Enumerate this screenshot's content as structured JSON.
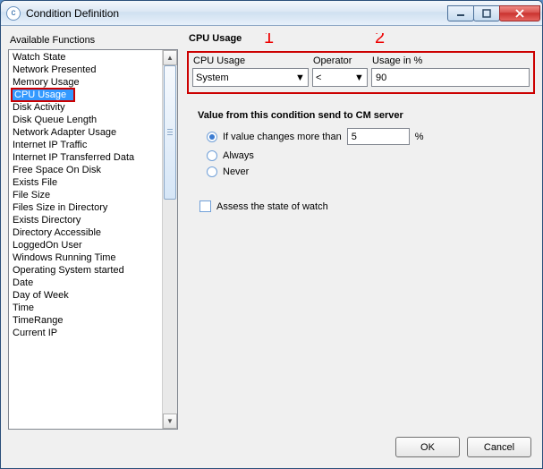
{
  "window": {
    "title": "Condition Definition"
  },
  "left": {
    "header": "Available Functions",
    "items": [
      "Watch State",
      "Network Presented",
      "Memory Usage",
      "CPU Usage",
      "Disk Activity",
      "Disk Queue Length",
      "Network Adapter Usage",
      "Internet IP Traffic",
      "Internet IP Transferred Data",
      "Free Space On Disk",
      "Exists File",
      "File Size",
      "Files Size in Directory",
      "Exists Directory",
      "Directory Accessible",
      "LoggedOn User",
      "Windows Running Time",
      "Operating System started",
      "Date",
      "Day of Week",
      "Time",
      "TimeRange",
      "Current IP"
    ],
    "selected_index": 3
  },
  "right": {
    "header": "CPU Usage",
    "annot1": "1",
    "annot2": "2",
    "group": {
      "cpu_label": "CPU Usage",
      "cpu_value": "System",
      "operator_label": "Operator",
      "operator_value": "<",
      "usage_label": "Usage in %",
      "usage_value": "90"
    },
    "value_section": {
      "title": "Value from this condition send to CM server",
      "opt_change": "If value changes more than",
      "opt_change_value": "5",
      "opt_change_unit": "%",
      "opt_always": "Always",
      "opt_never": "Never",
      "selected": "change"
    },
    "assess_label": "Assess the state of watch"
  },
  "buttons": {
    "ok": "OK",
    "cancel": "Cancel"
  }
}
